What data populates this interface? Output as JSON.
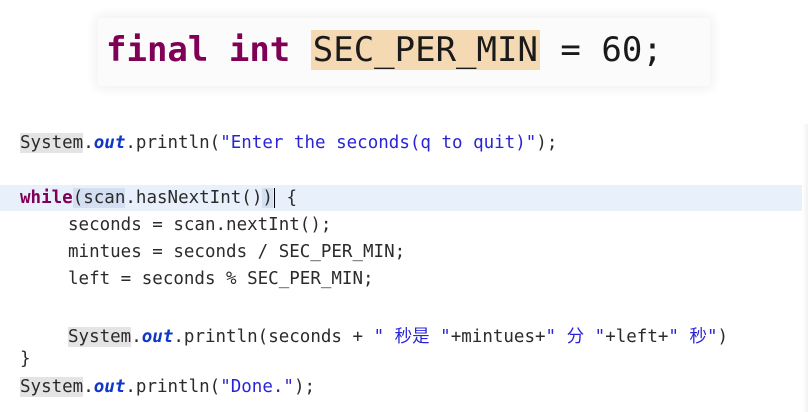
{
  "declaration": {
    "keyword_final": "final",
    "keyword_int": "int",
    "constant_name": "SEC_PER_MIN",
    "assign": " = ",
    "value": "60",
    "semicolon": ";"
  },
  "code": {
    "line1": {
      "class": "System",
      "dot1": ".",
      "field": "out",
      "call": ".println(",
      "string": "\"Enter the seconds(q to quit)\"",
      "end": ");"
    },
    "line2": {
      "keyword": "while",
      "open": "(",
      "obj": "scan",
      "method": ".hasNextInt()",
      "close": ")",
      "brace": " {"
    },
    "line3": "seconds = scan.nextInt();",
    "line4": "mintues = seconds / SEC_PER_MIN;",
    "line5": "left = seconds % SEC_PER_MIN;",
    "line6": {
      "class": "System",
      "dot1": ".",
      "field": "out",
      "call": ".println(seconds + ",
      "str1": "\" 秒是 \"",
      "mid1": "+mintues+",
      "str2": "\" 分 \"",
      "mid2": "+left+",
      "str3": "\" 秒\"",
      "end": ")"
    },
    "line7": "}",
    "line8": {
      "class": "System",
      "dot1": ".",
      "field": "out",
      "call": ".println(",
      "string": "\"Done.\"",
      "end": ");"
    }
  }
}
